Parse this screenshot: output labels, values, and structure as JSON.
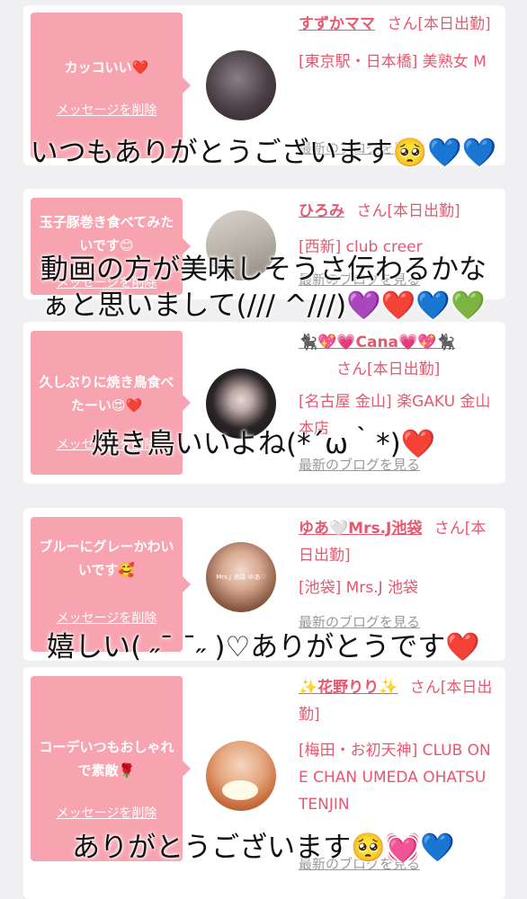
{
  "cards": [
    {
      "bubble": "カッコいい❤️",
      "delete_label": "メッセージを削除",
      "name": "すずかママ",
      "suffix": "さん[本日出勤]",
      "area_shop": "[東京駅・日本橋] 美熟女 M",
      "blog_link": "最新のブログを見る"
    },
    {
      "bubble": "玉子豚巻き食べてみたいです😊",
      "delete_label": "メッセージを削除",
      "name": "ひろみ",
      "suffix": "さん[本日出勤]",
      "area_shop": "[西新] club creer",
      "blog_link": "最新のブログを見る"
    },
    {
      "bubble": "久しぶりに焼き鳥食べたーい😍❤️",
      "delete_label": "メッセージを削除",
      "name": "🐈‍⬛💖💗Cana💗💖🐈‍⬛",
      "suffix": "さん[本日出勤]",
      "area_shop": "[名古屋 金山] 楽GAKU 金山本店",
      "blog_link": "最新のブログを見る"
    },
    {
      "bubble": "ブルーにグレーかわいいです🥰",
      "delete_label": "メッセージを削除",
      "name": "ゆあ🤍Mrs.J池袋",
      "suffix": "さん[本日出勤]",
      "area_shop": "[池袋] Mrs.J 池袋",
      "blog_link": "最新のブログを見る",
      "avatar_text": "Mrs.J 池袋 ゆあ♡"
    },
    {
      "bubble": "コーデいつもおしゃれで素敵🌹",
      "delete_label": "メッセージを削除",
      "name": "✨花野りり✨",
      "suffix": "さん[本日出勤]",
      "area_shop": "[梅田・お初天神] CLUB ONE CHAN UMEDA OHATSUTENJIN",
      "blog_link": "最新のブログを見る"
    }
  ],
  "captions": {
    "c1": "いつもありがとうございます🥺💙💙",
    "c2_line1": "動画の方が美味しそうさ伝わるかな",
    "c2_line2": "ぁと思いまして(/// ^///)💜❤️💙💚",
    "c3": "焼き鳥いいよね(*´ω｀*)❤️",
    "c4": "嬉しい( ˶¯ ¯˶ )♡ありがとうです❤️",
    "c5": "ありがとうございます🥺💓💙"
  },
  "colors": {
    "accent": "#e8576e",
    "bubble": "#f7a4b0",
    "background": "#f0f0f2"
  }
}
